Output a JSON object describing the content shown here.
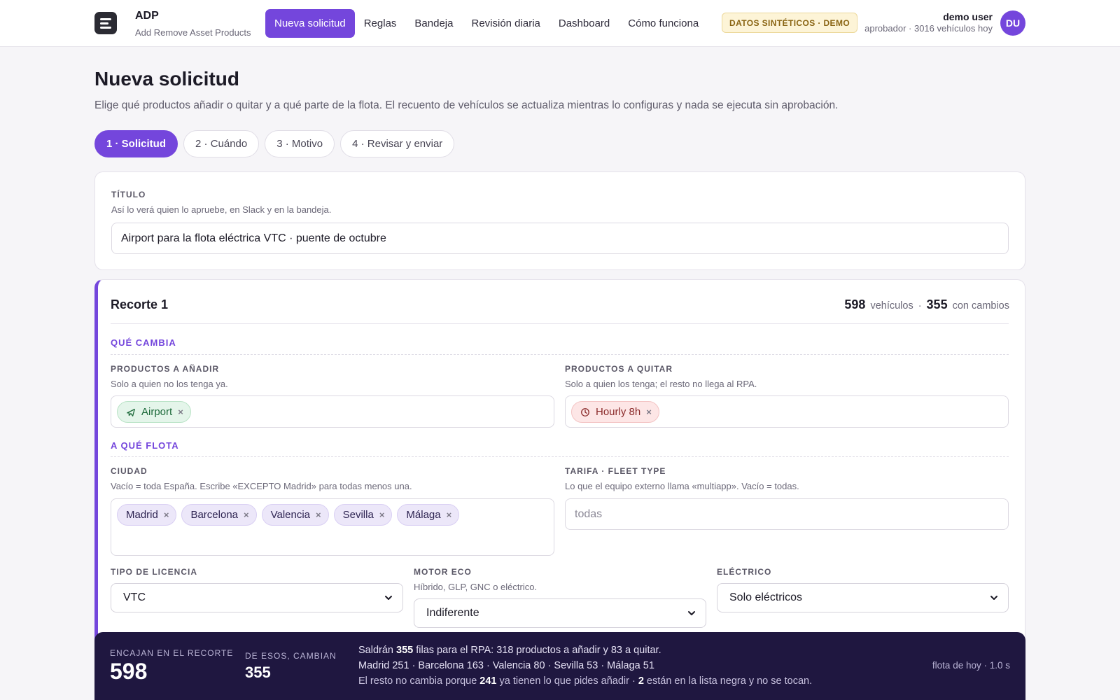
{
  "app": {
    "name": "ADP",
    "subtitle": "Add Remove Asset Products"
  },
  "nav": {
    "items": [
      {
        "label": "Nueva solicitud",
        "active": true
      },
      {
        "label": "Reglas"
      },
      {
        "label": "Bandeja"
      },
      {
        "label": "Revisión diaria"
      },
      {
        "label": "Dashboard"
      },
      {
        "label": "Cómo funciona"
      }
    ]
  },
  "badge": "DATOS SINTÉTICOS · DEMO",
  "user": {
    "name": "demo user",
    "role": "aprobador · 3016 vehículos hoy",
    "initials": "DU"
  },
  "page": {
    "title": "Nueva solicitud",
    "description": "Elige qué productos añadir o quitar y a qué parte de la flota. El recuento de vehículos se actualiza mientras lo configuras y nada se ejecuta sin aprobación."
  },
  "steps": [
    {
      "label": "1 · Solicitud",
      "active": true
    },
    {
      "label": "2 · Cuándo"
    },
    {
      "label": "3 · Motivo"
    },
    {
      "label": "4 · Revisar y enviar"
    }
  ],
  "titulo": {
    "label": "TÍTULO",
    "hint": "Así lo verá quien lo apruebe, en Slack y en la bandeja.",
    "value": "Airport para la flota eléctrica VTC · puente de octubre"
  },
  "recorte": {
    "title": "Recorte 1",
    "vehicles": "598",
    "vehicles_label": "vehículos",
    "sep": "·",
    "changes": "355",
    "changes_label": "con cambios",
    "que_cambia": "QUÉ CAMBIA",
    "add": {
      "label": "PRODUCTOS A AÑADIR",
      "hint": "Solo a quien no los tenga ya.",
      "chips": [
        {
          "label": "Airport",
          "icon": "plane-icon"
        }
      ]
    },
    "remove": {
      "label": "PRODUCTOS A QUITAR",
      "hint": "Solo a quien los tenga; el resto no llega al RPA.",
      "chips": [
        {
          "label": "Hourly 8h",
          "icon": "clock-icon"
        }
      ]
    },
    "a_que_flota": "A QUÉ FLOTA",
    "ciudad": {
      "label": "CIUDAD",
      "hint": "Vacío = toda España. Escribe «EXCEPTO Madrid» para todas menos una.",
      "chips": [
        "Madrid",
        "Barcelona",
        "Valencia",
        "Sevilla",
        "Málaga"
      ]
    },
    "tarifa": {
      "label": "TARIFA · FLEET TYPE",
      "hint": "Lo que el equipo externo llama «multiapp». Vacío = todas.",
      "placeholder": "todas"
    },
    "licencia": {
      "label": "TIPO DE LICENCIA",
      "value": "VTC"
    },
    "motor": {
      "label": "MOTOR ECO",
      "hint": "Híbrido, GLP, GNC o eléctrico.",
      "value": "Indiferente"
    },
    "electrico": {
      "label": "ELÉCTRICO",
      "value": "Solo eléctricos"
    }
  },
  "summary": {
    "match_label": "ENCAJAN EN EL RECORTE",
    "match_value": "598",
    "change_label": "DE ESOS, CAMBIAN",
    "change_value": "355",
    "line1_a": "Saldrán ",
    "line1_b": "355",
    "line1_c": " filas para el RPA: 318 productos a añadir y 83 a quitar.",
    "line2": "Madrid 251 · Barcelona 163 · Valencia 80 · Sevilla 53 · Málaga 51",
    "line3_a": "El resto no cambia porque ",
    "line3_b": "241",
    "line3_c": " ya tienen lo que pides añadir · ",
    "line3_d": "2",
    "line3_e": " están en la lista negra y no se tocan.",
    "right": "flota de hoy · 1.0 s"
  },
  "colors": {
    "accent": "#7446dc",
    "summary_bg": "#1f1740",
    "badge_bg": "#fdf4d7"
  }
}
